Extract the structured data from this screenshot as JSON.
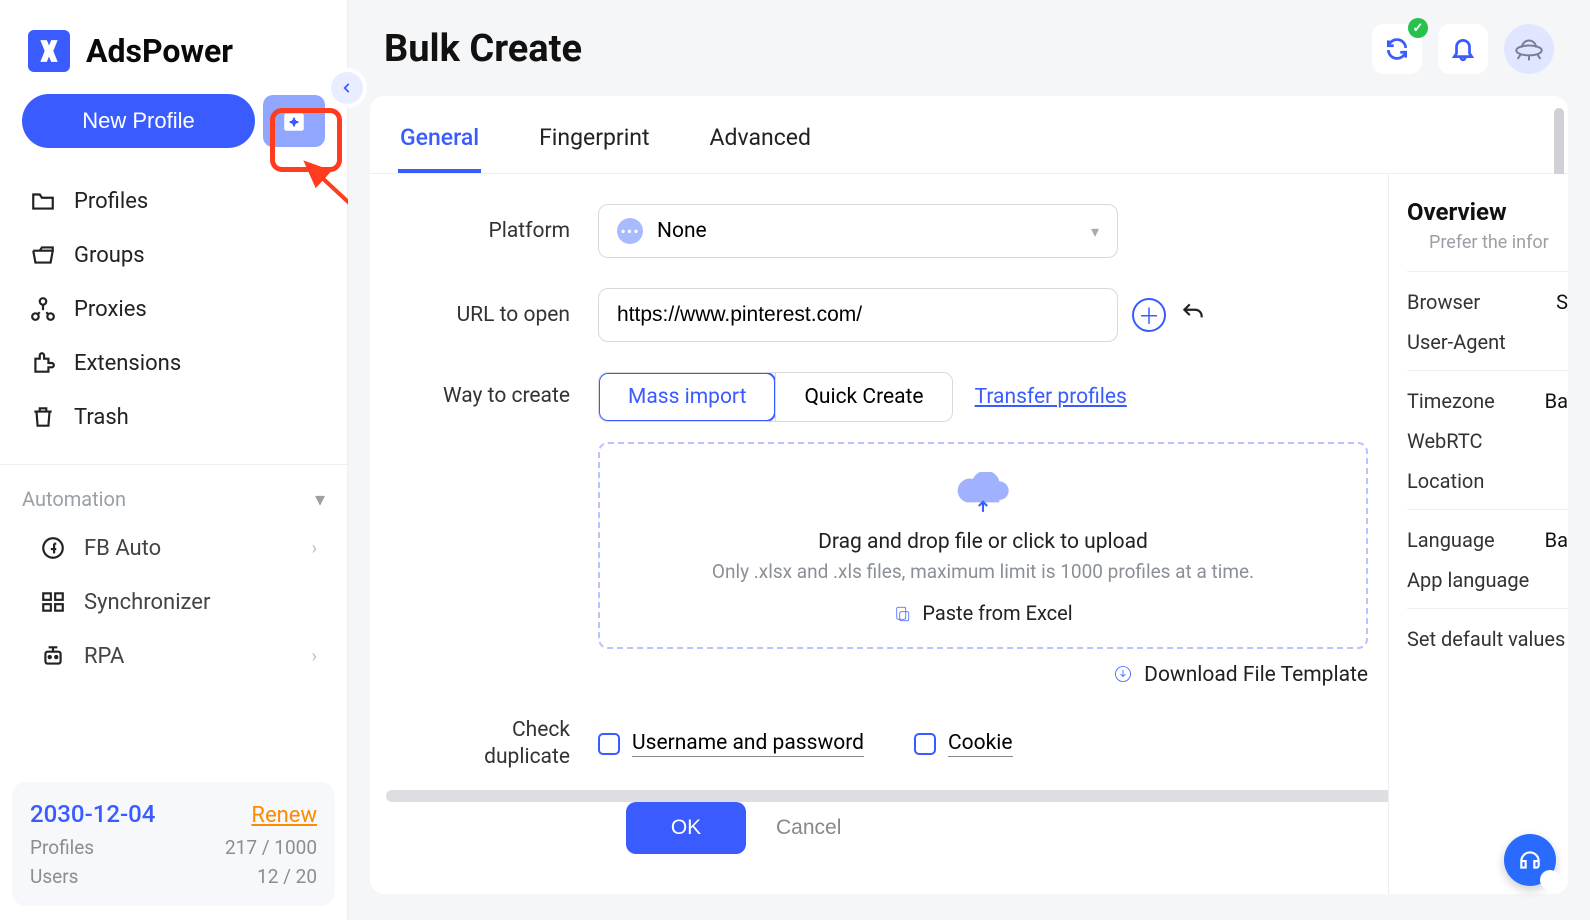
{
  "brand": "AdsPower",
  "sidebar": {
    "new_profile_label": "New Profile",
    "items": [
      {
        "label": "Profiles"
      },
      {
        "label": "Groups"
      },
      {
        "label": "Proxies"
      },
      {
        "label": "Extensions"
      },
      {
        "label": "Trash"
      }
    ],
    "automation_label": "Automation",
    "automation_items": [
      {
        "label": "FB Auto"
      },
      {
        "label": "Synchronizer"
      },
      {
        "label": "RPA"
      }
    ],
    "footer": {
      "date": "2030-12-04",
      "renew": "Renew",
      "profiles_label": "Profiles",
      "profiles_value": "217 / 1000",
      "users_label": "Users",
      "users_value": "12 / 20"
    }
  },
  "page_title": "Bulk Create",
  "tabs": {
    "general": "General",
    "fingerprint": "Fingerprint",
    "advanced": "Advanced"
  },
  "form": {
    "platform_label": "Platform",
    "platform_value": "None",
    "url_label": "URL to open",
    "url_value": "https://www.pinterest.com/",
    "way_label": "Way to create",
    "mass_import": "Mass import",
    "quick_create": "Quick Create",
    "transfer_profiles": "Transfer profiles",
    "dropzone_line1": "Drag and drop file or click to upload",
    "dropzone_line2": "Only .xlsx and .xls files, maximum limit is 1000 profiles at a time.",
    "paste_excel": "Paste from Excel",
    "download_template": "Download File Template",
    "check_dup_label_1": "Check",
    "check_dup_label_2": "duplicate",
    "chk_userpass": "Username and password",
    "chk_cookie": "Cookie",
    "ok": "OK",
    "cancel": "Cancel"
  },
  "overview": {
    "title": "Overview",
    "subtitle": "Prefer the infor",
    "rows": [
      {
        "label": "Browser",
        "val": "S"
      },
      {
        "label": "User-Agent",
        "val": ""
      },
      {
        "label": "Timezone",
        "val": "Ba"
      },
      {
        "label": "WebRTC",
        "val": ""
      },
      {
        "label": "Location",
        "val": ""
      },
      {
        "label": "Language",
        "val": "Ba"
      },
      {
        "label": "App language",
        "val": ""
      }
    ],
    "set_defaults": "Set default values"
  }
}
